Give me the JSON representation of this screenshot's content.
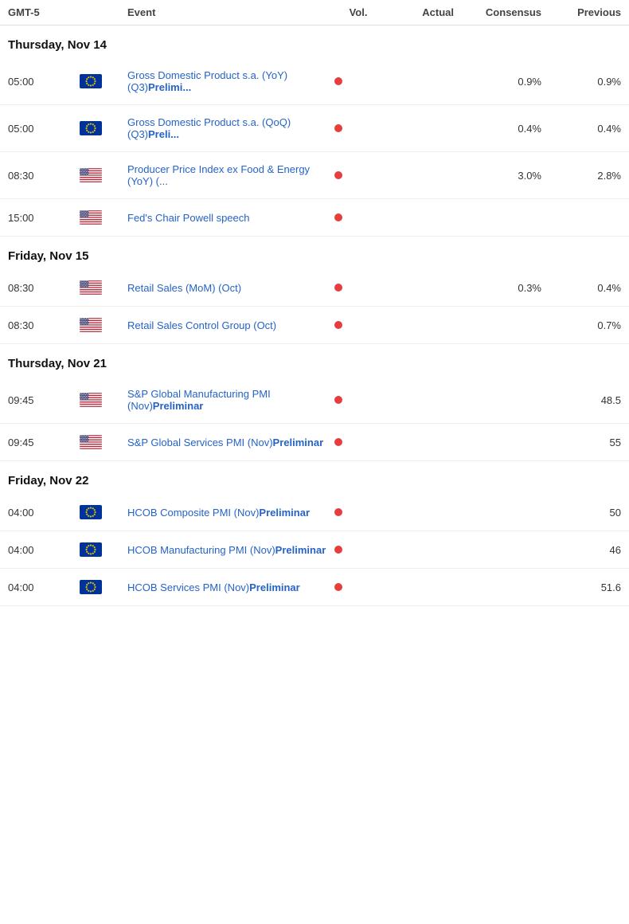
{
  "header": {
    "timezone": "GMT-5",
    "event": "Event",
    "vol": "Vol.",
    "actual": "Actual",
    "consensus": "Consensus",
    "previous": "Previous"
  },
  "sections": [
    {
      "id": "thursday-nov14",
      "label": "Thursday, Nov 14",
      "events": [
        {
          "time": "05:00",
          "flag": "eu",
          "name": "Gross Domestic Product s.a. (YoY) (Q3)",
          "bold": "Prelimi...",
          "hasDot": true,
          "actual": "",
          "consensus": "0.9%",
          "previous": "0.9%"
        },
        {
          "time": "05:00",
          "flag": "eu",
          "name": "Gross Domestic Product s.a. (QoQ) (Q3)",
          "bold": "Preli...",
          "hasDot": true,
          "actual": "",
          "consensus": "0.4%",
          "previous": "0.4%"
        },
        {
          "time": "08:30",
          "flag": "us",
          "name": "Producer Price Index ex Food & Energy (YoY) (... ",
          "bold": "",
          "hasDot": true,
          "actual": "",
          "consensus": "3.0%",
          "previous": "2.8%"
        },
        {
          "time": "15:00",
          "flag": "us",
          "name": "Fed's Chair Powell speech",
          "bold": "",
          "hasDot": true,
          "actual": "",
          "consensus": "",
          "previous": ""
        }
      ]
    },
    {
      "id": "friday-nov15",
      "label": "Friday, Nov 15",
      "events": [
        {
          "time": "08:30",
          "flag": "us",
          "name": "Retail Sales (MoM) (Oct)",
          "bold": "",
          "hasDot": true,
          "actual": "",
          "consensus": "0.3%",
          "previous": "0.4%"
        },
        {
          "time": "08:30",
          "flag": "us",
          "name": "Retail Sales Control Group (Oct)",
          "bold": "",
          "hasDot": true,
          "actual": "",
          "consensus": "",
          "previous": "0.7%"
        }
      ]
    },
    {
      "id": "thursday-nov21",
      "label": "Thursday, Nov 21",
      "events": [
        {
          "time": "09:45",
          "flag": "us",
          "name": "S&P Global Manufacturing PMI (Nov)",
          "bold": "Preliminar",
          "hasDot": true,
          "actual": "",
          "consensus": "",
          "previous": "48.5"
        },
        {
          "time": "09:45",
          "flag": "us",
          "name": "S&P Global Services PMI (Nov)",
          "bold": "Preliminar",
          "hasDot": true,
          "actual": "",
          "consensus": "",
          "previous": "55"
        }
      ]
    },
    {
      "id": "friday-nov22",
      "label": "Friday, Nov 22",
      "events": [
        {
          "time": "04:00",
          "flag": "eu",
          "name": "HCOB Composite PMI (Nov)",
          "bold": "Preliminar",
          "hasDot": true,
          "actual": "",
          "consensus": "",
          "previous": "50"
        },
        {
          "time": "04:00",
          "flag": "eu",
          "name": "HCOB Manufacturing PMI (Nov)",
          "bold": "Preliminar",
          "hasDot": true,
          "actual": "",
          "consensus": "",
          "previous": "46"
        },
        {
          "time": "04:00",
          "flag": "eu",
          "name": "HCOB Services PMI (Nov)",
          "bold": "Preliminar",
          "hasDot": true,
          "actual": "",
          "consensus": "",
          "previous": "51.6"
        }
      ]
    }
  ]
}
